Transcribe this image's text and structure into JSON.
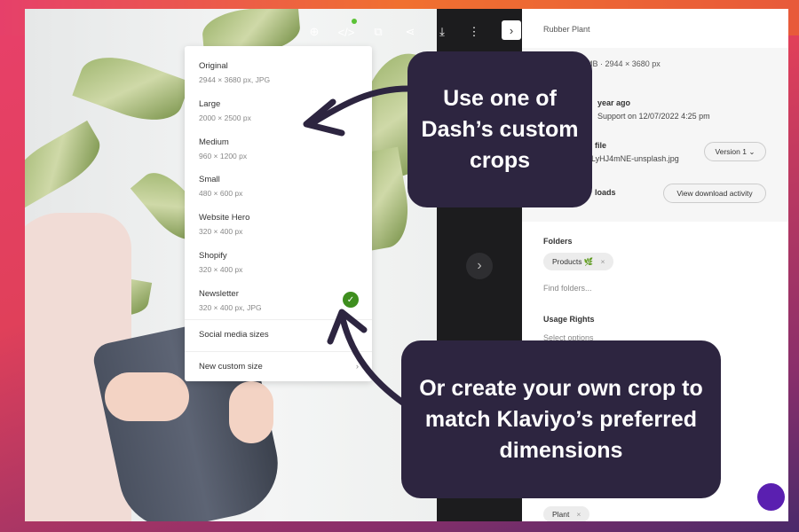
{
  "toolbar": {
    "icons": [
      "zoom-in-icon",
      "embed-code-icon",
      "add-to-collection-icon",
      "share-icon",
      "download-icon",
      "more-icon"
    ],
    "collapse_icon": "chevron-right-icon"
  },
  "crop_menu": {
    "items": [
      {
        "title": "Original",
        "size": "2944 × 3680 px, JPG"
      },
      {
        "title": "Large",
        "size": "2000 × 2500 px"
      },
      {
        "title": "Medium",
        "size": "960 × 1200 px"
      },
      {
        "title": "Small",
        "size": "480 × 600 px"
      },
      {
        "title": "Website Hero",
        "size": "320 × 400 px"
      },
      {
        "title": "Shopify",
        "size": "320 × 400 px"
      },
      {
        "title": "Newsletter",
        "size": "320 × 400 px, JPG",
        "selected": true
      }
    ],
    "social": "Social media sizes",
    "custom": "New custom size"
  },
  "side": {
    "title": "Rubber Plant",
    "file_meta": "MB  ·  2944 × 3680 px",
    "uploaded": "year ago",
    "uploaded_by": "Support on 12/07/2022 4:25 pm",
    "file_label": "file",
    "file_name": "KLyHJ4mNE-unsplash.jpg",
    "version": "Version 1",
    "downloads_label": "loads",
    "download_activity": "View download activity",
    "folders_label": "Folders",
    "folder_chip": "Products 🌿",
    "find_folders": "Find folders...",
    "usage_label": "Usage Rights",
    "usage_placeholder": "Select options",
    "tag_chip": "Plant"
  },
  "callouts": {
    "top": "Use one of Dash’s custom crops",
    "bottom": "Or create your own crop to match Klaviyo’s preferred dimensions"
  },
  "colors": {
    "callout": "#2d2540",
    "check": "#3e8e1e",
    "chat": "#5a1fb0"
  }
}
